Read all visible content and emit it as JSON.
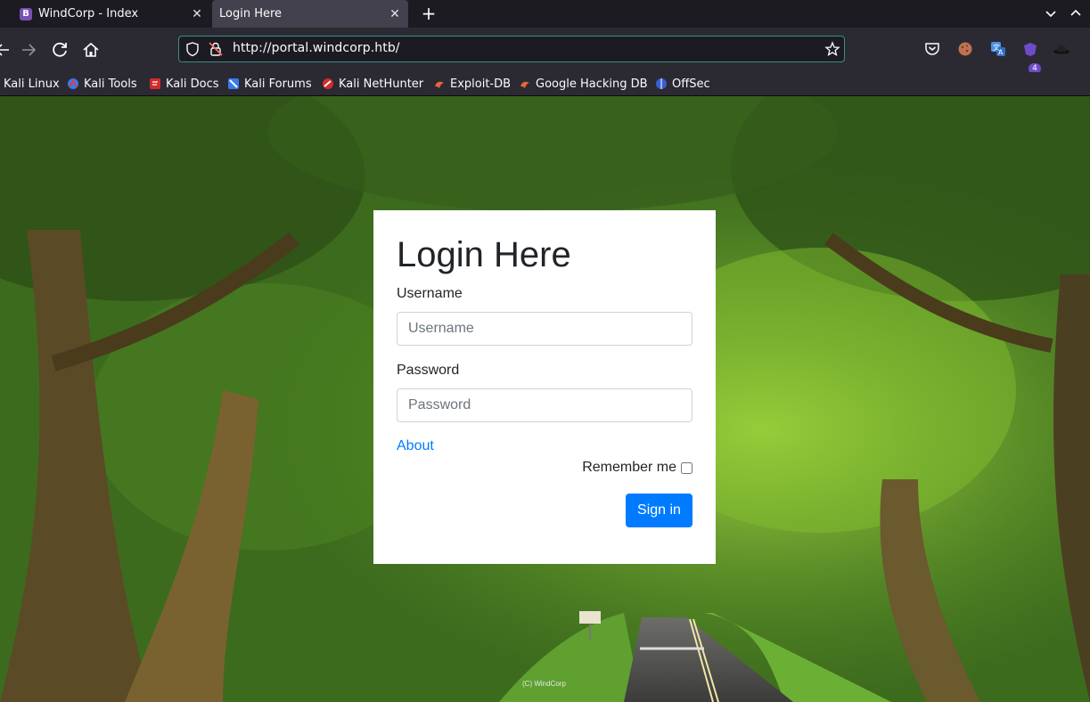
{
  "browser": {
    "tabs": [
      {
        "title": "WindCorp - Index",
        "favicon": "B",
        "active": false
      },
      {
        "title": "Login Here",
        "active": true
      }
    ],
    "new_tab": "+",
    "url": "http://portal.windcorp.htb/",
    "extension_badge": "4",
    "bookmarks": [
      {
        "label": "Kali Linux",
        "icon": "kali-dragon-icon"
      },
      {
        "label": "Kali Tools",
        "icon": "kali-tools-icon"
      },
      {
        "label": "Kali Docs",
        "icon": "kali-docs-icon"
      },
      {
        "label": "Kali Forums",
        "icon": "kali-forums-icon"
      },
      {
        "label": "Kali NetHunter",
        "icon": "kali-nethunter-icon"
      },
      {
        "label": "Exploit-DB",
        "icon": "exploit-db-icon"
      },
      {
        "label": "Google Hacking DB",
        "icon": "ghdb-icon"
      },
      {
        "label": "OffSec",
        "icon": "offsec-icon"
      }
    ]
  },
  "login": {
    "title": "Login Here",
    "username_label": "Username",
    "username_placeholder": "Username",
    "password_label": "Password",
    "password_placeholder": "Password",
    "about_link": "About",
    "remember_label": "Remember me",
    "signin_label": "Sign in",
    "colors": {
      "primary": "#007bff",
      "text": "#212529"
    }
  },
  "footer": {
    "copyright": "(C) WindCorp"
  }
}
